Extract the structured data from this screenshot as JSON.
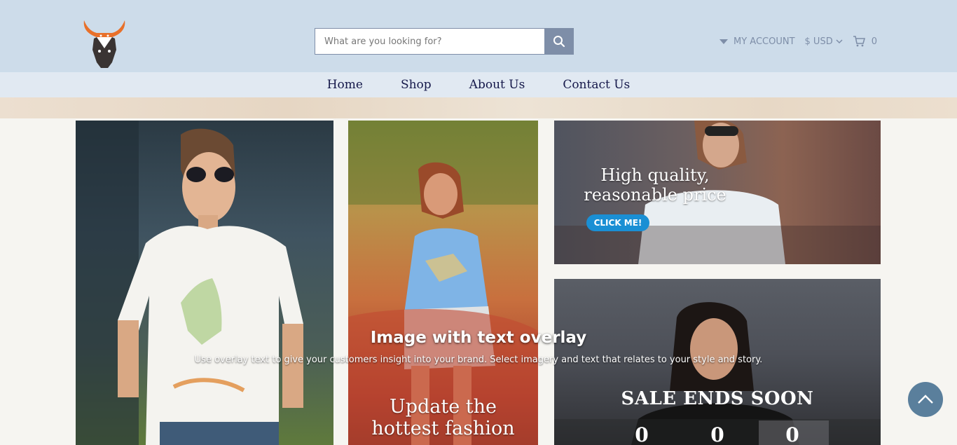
{
  "header": {
    "logo_name": "bull-head-logo",
    "search": {
      "placeholder": "What are you looking for?"
    },
    "account_label": "MY ACCOUNT",
    "currency": "$ USD",
    "cart_count": "0"
  },
  "nav": {
    "items": [
      {
        "label": "Home"
      },
      {
        "label": "Shop"
      },
      {
        "label": "About Us"
      },
      {
        "label": "Contact Us"
      }
    ]
  },
  "promo_top_right": {
    "line1": "High quality,",
    "line2": "reasonable price",
    "button": "CLICK ME!"
  },
  "promo_middle": {
    "line1": "Update the",
    "line2": "hottest fashion"
  },
  "overlay": {
    "heading": "Image with text overlay",
    "subheading": "Use overlay text to give your customers insight into your brand. Select imagery and text that relates to your style and story."
  },
  "sale": {
    "title": "SALE ENDS SOON",
    "counters": [
      "0",
      "0",
      "0"
    ]
  },
  "colors": {
    "header_bg": "#cddcea",
    "nav_bg": "#e1e9f2",
    "accent": "#7e8ea8",
    "button_blue": "#1a8fd4",
    "scroll_top_bg": "#5a7f9c"
  }
}
